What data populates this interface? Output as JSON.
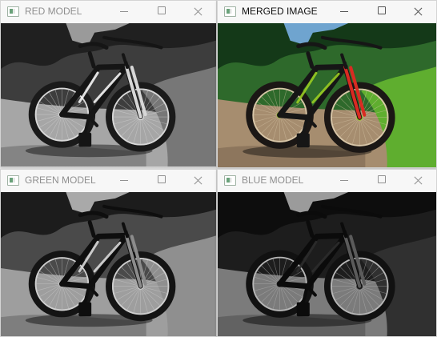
{
  "windows": [
    {
      "key": "red",
      "title": "RED MODEL",
      "active": false,
      "mode": "red"
    },
    {
      "key": "merged",
      "title": "MERGED IMAGE",
      "active": true,
      "mode": "merged"
    },
    {
      "key": "green",
      "title": "GREEN MODEL",
      "active": false,
      "mode": "green"
    },
    {
      "key": "blue",
      "title": "BLUE MODEL",
      "active": false,
      "mode": "blue"
    }
  ],
  "icons": {
    "app": "app-window-icon",
    "minimize": "minimize-icon",
    "maximize": "maximize-icon",
    "close": "close-icon"
  },
  "colors": {
    "merged_frame": "#99cc22",
    "merged_fork": "#d92b22",
    "merged_sky": "#6fa4cf",
    "merged_grass": "#5fae2f",
    "merged_road": "#a68d6f"
  }
}
